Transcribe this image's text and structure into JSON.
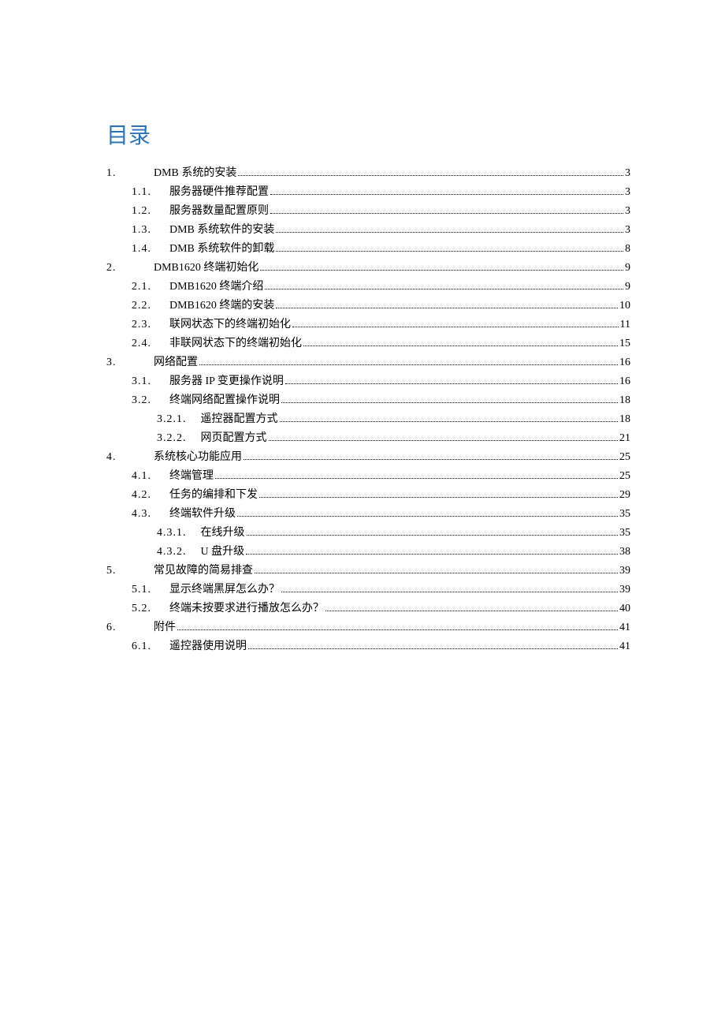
{
  "title": "目录",
  "entries": [
    {
      "level": 1,
      "num": "1.",
      "text": "DMB 系统的安装 ",
      "page": "3"
    },
    {
      "level": 2,
      "num": "1.1.",
      "text": "服务器硬件推荐配置",
      "page": "3"
    },
    {
      "level": 2,
      "num": "1.2.",
      "text": "服务器数量配置原则",
      "page": "3"
    },
    {
      "level": 2,
      "num": "1.3.",
      "text": "DMB 系统软件的安装",
      "page": "3"
    },
    {
      "level": 2,
      "num": "1.4.",
      "text": "DMB 系统软件的卸载",
      "page": "8"
    },
    {
      "level": 1,
      "num": "2.",
      "text": "DMB1620 终端初始化 ",
      "page": "9"
    },
    {
      "level": 2,
      "num": "2.1.",
      "text": "DMB1620 终端介绍",
      "page": "9"
    },
    {
      "level": 2,
      "num": "2.2.",
      "text": "DMB1620 终端的安装",
      "page": "10"
    },
    {
      "level": 2,
      "num": "2.3.",
      "text": "联网状态下的终端初始化",
      "page": "11"
    },
    {
      "level": 2,
      "num": "2.4.",
      "text": "非联网状态下的终端初始化",
      "page": "15"
    },
    {
      "level": 1,
      "num": "3.",
      "text": "网络配置 ",
      "page": "16"
    },
    {
      "level": 2,
      "num": "3.1.",
      "text": "服务器 IP 变更操作说明",
      "page": "16"
    },
    {
      "level": 2,
      "num": "3.2.",
      "text": "终端网络配置操作说明",
      "page": "18"
    },
    {
      "level": 3,
      "num": "3.2.1.",
      "text": "遥控器配置方式",
      "page": "18"
    },
    {
      "level": 3,
      "num": "3.2.2.",
      "text": "网页配置方式",
      "page": "21"
    },
    {
      "level": 1,
      "num": "4.",
      "text": "系统核心功能应用 ",
      "page": "25"
    },
    {
      "level": 2,
      "num": "4.1.",
      "text": "终端管理 ",
      "page": "25"
    },
    {
      "level": 2,
      "num": "4.2.",
      "text": "任务的编排和下发",
      "page": "29"
    },
    {
      "level": 2,
      "num": "4.3.",
      "text": "终端软件升级 ",
      "page": "35"
    },
    {
      "level": 3,
      "num": "4.3.1.",
      "text": "在线升级 ",
      "page": "35"
    },
    {
      "level": 3,
      "num": "4.3.2.",
      "text": "U 盘升级 ",
      "page": "38"
    },
    {
      "level": 1,
      "num": "5.",
      "text": "常见故障的简易排查 ",
      "page": "39"
    },
    {
      "level": 2,
      "num": "5.1.",
      "text": "显示终端黑屏怎么办？ ",
      "page": "39"
    },
    {
      "level": 2,
      "num": "5.2.",
      "text": "终端未按要求进行播放怎么办？ ",
      "page": "40"
    },
    {
      "level": 1,
      "num": "6.",
      "text": "附件 ",
      "page": "41"
    },
    {
      "level": 2,
      "num": "6.1.",
      "text": "遥控器使用说明 ",
      "page": "41"
    }
  ]
}
